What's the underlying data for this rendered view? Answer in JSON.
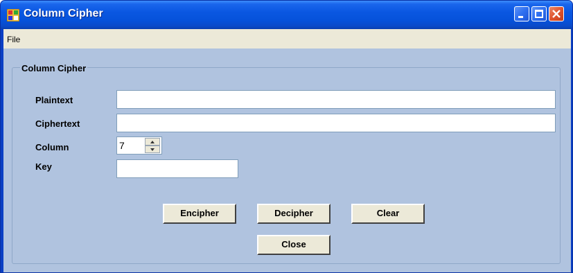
{
  "window": {
    "title": "Column Cipher",
    "colors": {
      "titlebar": "#0a57e1",
      "client": "#b0c3df",
      "menubar": "#ece9d8",
      "close_button": "#e0542e"
    }
  },
  "menu": {
    "items": [
      "File"
    ]
  },
  "group": {
    "title": "Column Cipher"
  },
  "fields": {
    "plaintext_label": "Plaintext",
    "plaintext_value": "",
    "ciphertext_label": "Ciphertext",
    "ciphertext_value": "",
    "column_label": "Column",
    "column_value": "7",
    "key_label": "Key",
    "key_value": ""
  },
  "buttons": {
    "encipher": "Encipher",
    "decipher": "Decipher",
    "clear": "Clear",
    "close": "Close"
  },
  "icons": {
    "app": "app-window-icon",
    "minimize": "minimize-icon",
    "maximize": "maximize-icon",
    "close": "close-icon",
    "spin_up": "spin-up-arrow-icon",
    "spin_down": "spin-down-arrow-icon"
  }
}
